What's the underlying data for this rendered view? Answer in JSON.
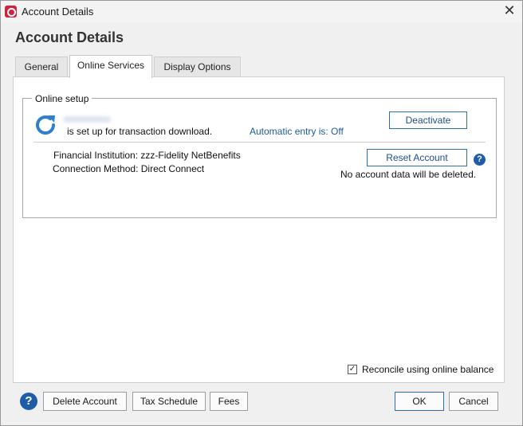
{
  "window": {
    "title": "Account Details",
    "close_glyph": "✕"
  },
  "heading": "Account Details",
  "tabs": [
    {
      "label": "General",
      "active": false
    },
    {
      "label": "Online Services",
      "active": true
    },
    {
      "label": "Display Options",
      "active": false
    }
  ],
  "online_setup": {
    "legend": "Online setup",
    "status_icon": "refresh-icon",
    "setup_text": "is set up for transaction download.",
    "automatic_entry": "Automatic entry is: Off",
    "deactivate_label": "Deactivate",
    "financial_institution": "Financial Institution: zzz-Fidelity NetBenefits",
    "connection_method": "Connection Method: Direct Connect",
    "reset_label": "Reset Account",
    "reset_note": "No account data will be deleted."
  },
  "reconcile": {
    "label": "Reconcile using online balance",
    "checked": true
  },
  "footer": {
    "help_glyph": "?",
    "delete_label": "Delete Account",
    "tax_label": "Tax Schedule",
    "fees_label": "Fees",
    "ok_label": "OK",
    "cancel_label": "Cancel"
  },
  "colors": {
    "accent": "#1f5da8",
    "brand": "#d3213d",
    "link": "#1e5a9a"
  }
}
